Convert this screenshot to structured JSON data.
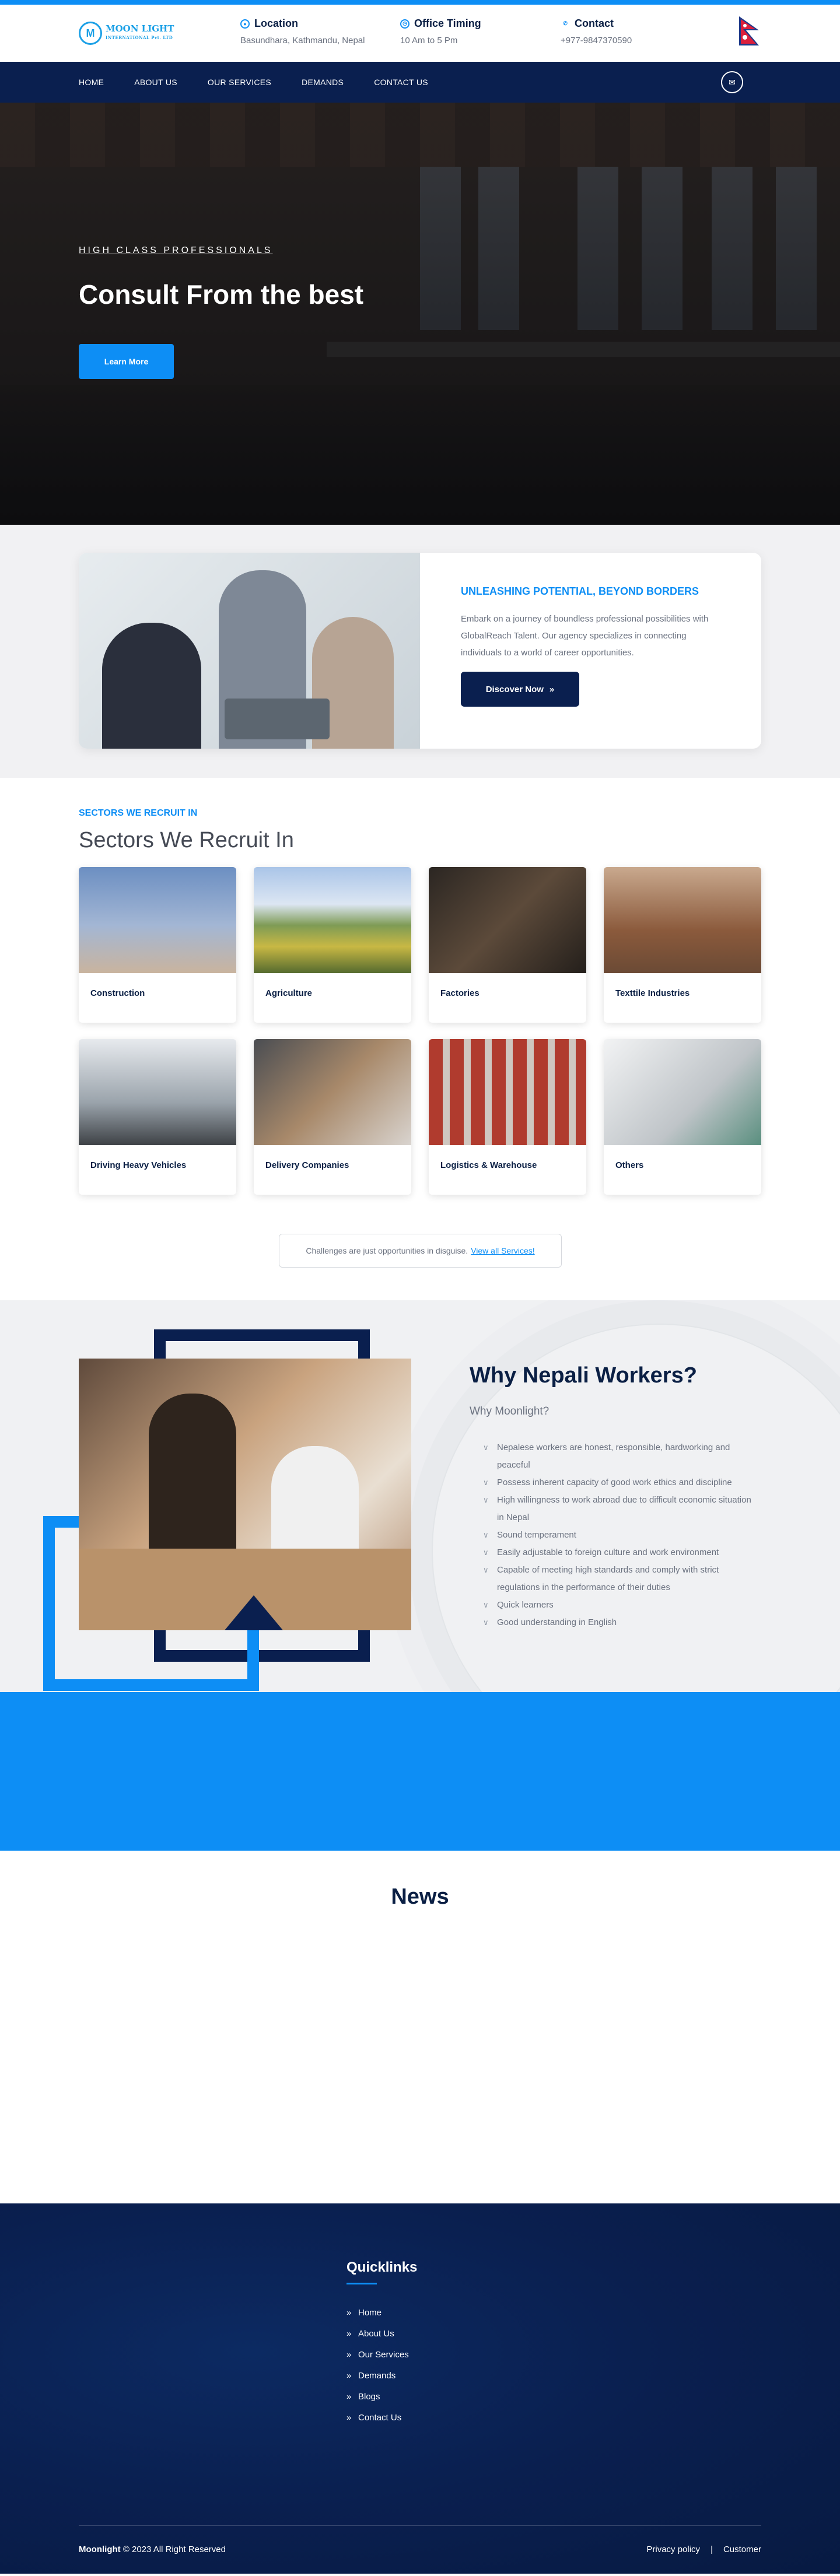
{
  "brand": {
    "logo_name": "MOON LIGHT",
    "logo_sub": "INTERNATIONAL Pvt. LTD",
    "logo_mark": "M"
  },
  "topbar": {
    "location": {
      "title": "Location",
      "value": "Basundhara, Kathmandu, Nepal",
      "icon": "location-icon"
    },
    "timing": {
      "title": "Office Timing",
      "value": "10 Am to 5 Pm",
      "icon": "clock-icon"
    },
    "contact": {
      "title": "Contact",
      "value": "+977-9847370590",
      "icon": "phone-icon"
    }
  },
  "nav": {
    "items": [
      "HOME",
      "ABOUT US",
      "OUR SERVICES",
      "DEMANDS",
      "CONTACT US"
    ],
    "mail_icon": "✉"
  },
  "hero": {
    "eyebrow": "HIGH CLASS PROFESSIONALS",
    "headline": "Consult From the best",
    "button": "Learn More"
  },
  "promo": {
    "kicker": "UNLEASHING POTENTIAL, BEYOND BORDERS",
    "body": "Embark on a journey of boundless professional possibilities with GlobalReach Talent. Our agency specializes in connecting individuals to a world of career opportunities.",
    "button": "Discover Now",
    "button_arrow": "»"
  },
  "sectors": {
    "kicker": "SECTORS WE RECRUIT IN",
    "heading": "Sectors We Recruit In",
    "cards": [
      {
        "label": "Construction"
      },
      {
        "label": "Agriculture"
      },
      {
        "label": "Factories"
      },
      {
        "label": "Texttile Industries"
      },
      {
        "label": "Driving Heavy Vehicles"
      },
      {
        "label": "Delivery Companies"
      },
      {
        "label": "Logistics & Warehouse"
      },
      {
        "label": "Others"
      }
    ],
    "challenge_text": "Challenges are just opportunities in disguise.",
    "challenge_link": "View all Services!"
  },
  "why": {
    "title": "Why Nepali Workers?",
    "subtitle": "Why Moonlight?",
    "points": [
      "Nepalese workers are honest, responsible, hardworking and peaceful",
      "Possess inherent capacity of good work ethics and discipline",
      "High willingness to work abroad due to difficult economic situation in Nepal",
      "Sound temperament",
      "Easily adjustable to foreign culture and work environment",
      "Capable of meeting high standards and comply with strict regulations in the performance of their duties",
      "Quick learners",
      "Good understanding in English"
    ]
  },
  "news": {
    "heading": "News"
  },
  "footer": {
    "quicklinks_title": "Quicklinks",
    "links": [
      "Home",
      "About Us",
      "Our Services",
      "Demands",
      "Blogs",
      "Contact Us"
    ],
    "copyright_brand": "Moonlight",
    "copyright_rest": "© 2023 All Right Reserved",
    "privacy": "Privacy policy",
    "separator": "|",
    "customer": "Customer"
  }
}
